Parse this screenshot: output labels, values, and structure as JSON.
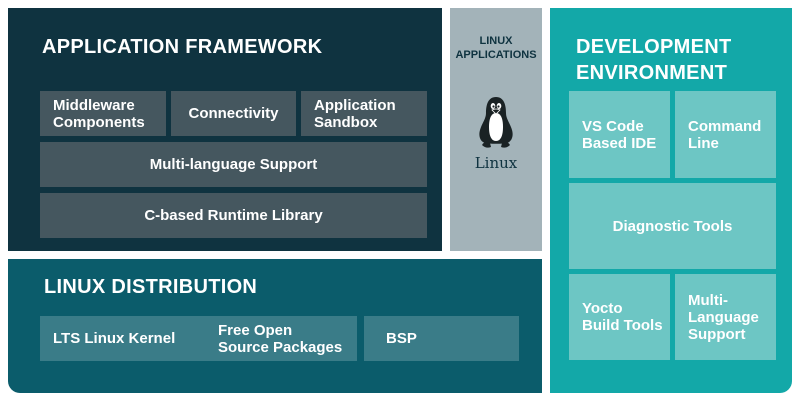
{
  "application_framework": {
    "title": "APPLICATION FRAMEWORK",
    "components": [
      {
        "label": "Middleware\nComponents"
      },
      {
        "label": "Connectivity"
      },
      {
        "label": "Application\nSandbox"
      },
      {
        "label": "Multi-language Support"
      },
      {
        "label": "C-based Runtime Library"
      }
    ]
  },
  "linux_applications": {
    "title_line1": "LINUX",
    "title_line2": "APPLICATIONS",
    "logo_caption": "Linux",
    "logo_icon": "tux-penguin-icon"
  },
  "linux_distribution": {
    "title": "LINUX DISTRIBUTION",
    "components": [
      {
        "label": "LTS Linux Kernel"
      },
      {
        "label": "Free Open\nSource Packages"
      },
      {
        "label": "BSP"
      }
    ]
  },
  "development_environment": {
    "title": "DEVELOPMENT\nENVIRONMENT",
    "components": [
      {
        "label": "VS Code\nBased IDE"
      },
      {
        "label": "Command\nLine"
      },
      {
        "label": "Diagnostic Tools"
      },
      {
        "label": "Yocto\nBuild Tools"
      },
      {
        "label": "Multi-\nLanguage\nSupport"
      }
    ]
  },
  "colors": {
    "framework_bg": "#0f3340",
    "framework_box": "#45575f",
    "apps_bg": "#a3b3b9",
    "distribution_bg": "#0b5c6b",
    "distribution_box": "#3a7c88",
    "devenv_bg": "#13a8a8",
    "devenv_box": "#6dc6c4"
  }
}
